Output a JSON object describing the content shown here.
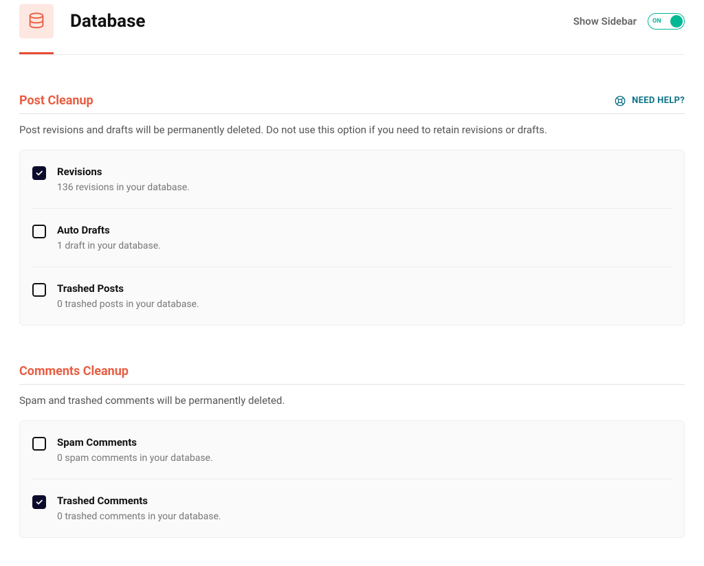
{
  "header": {
    "title": "Database",
    "show_sidebar_label": "Show Sidebar",
    "toggle_text": "ON"
  },
  "help": {
    "label": "NEED HELP?"
  },
  "sections": {
    "post_cleanup": {
      "title": "Post Cleanup",
      "desc": "Post revisions and drafts will be permanently deleted. Do not use this option if you need to retain revisions or drafts.",
      "items": [
        {
          "title": "Revisions",
          "sub": "136 revisions in your database.",
          "checked": true
        },
        {
          "title": "Auto Drafts",
          "sub": "1 draft in your database.",
          "checked": false
        },
        {
          "title": "Trashed Posts",
          "sub": "0 trashed posts in your database.",
          "checked": false
        }
      ]
    },
    "comments_cleanup": {
      "title": "Comments Cleanup",
      "desc": "Spam and trashed comments will be permanently deleted.",
      "items": [
        {
          "title": "Spam Comments",
          "sub": "0 spam comments in your database.",
          "checked": false
        },
        {
          "title": "Trashed Comments",
          "sub": "0 trashed comments in your database.",
          "checked": true
        }
      ]
    }
  }
}
